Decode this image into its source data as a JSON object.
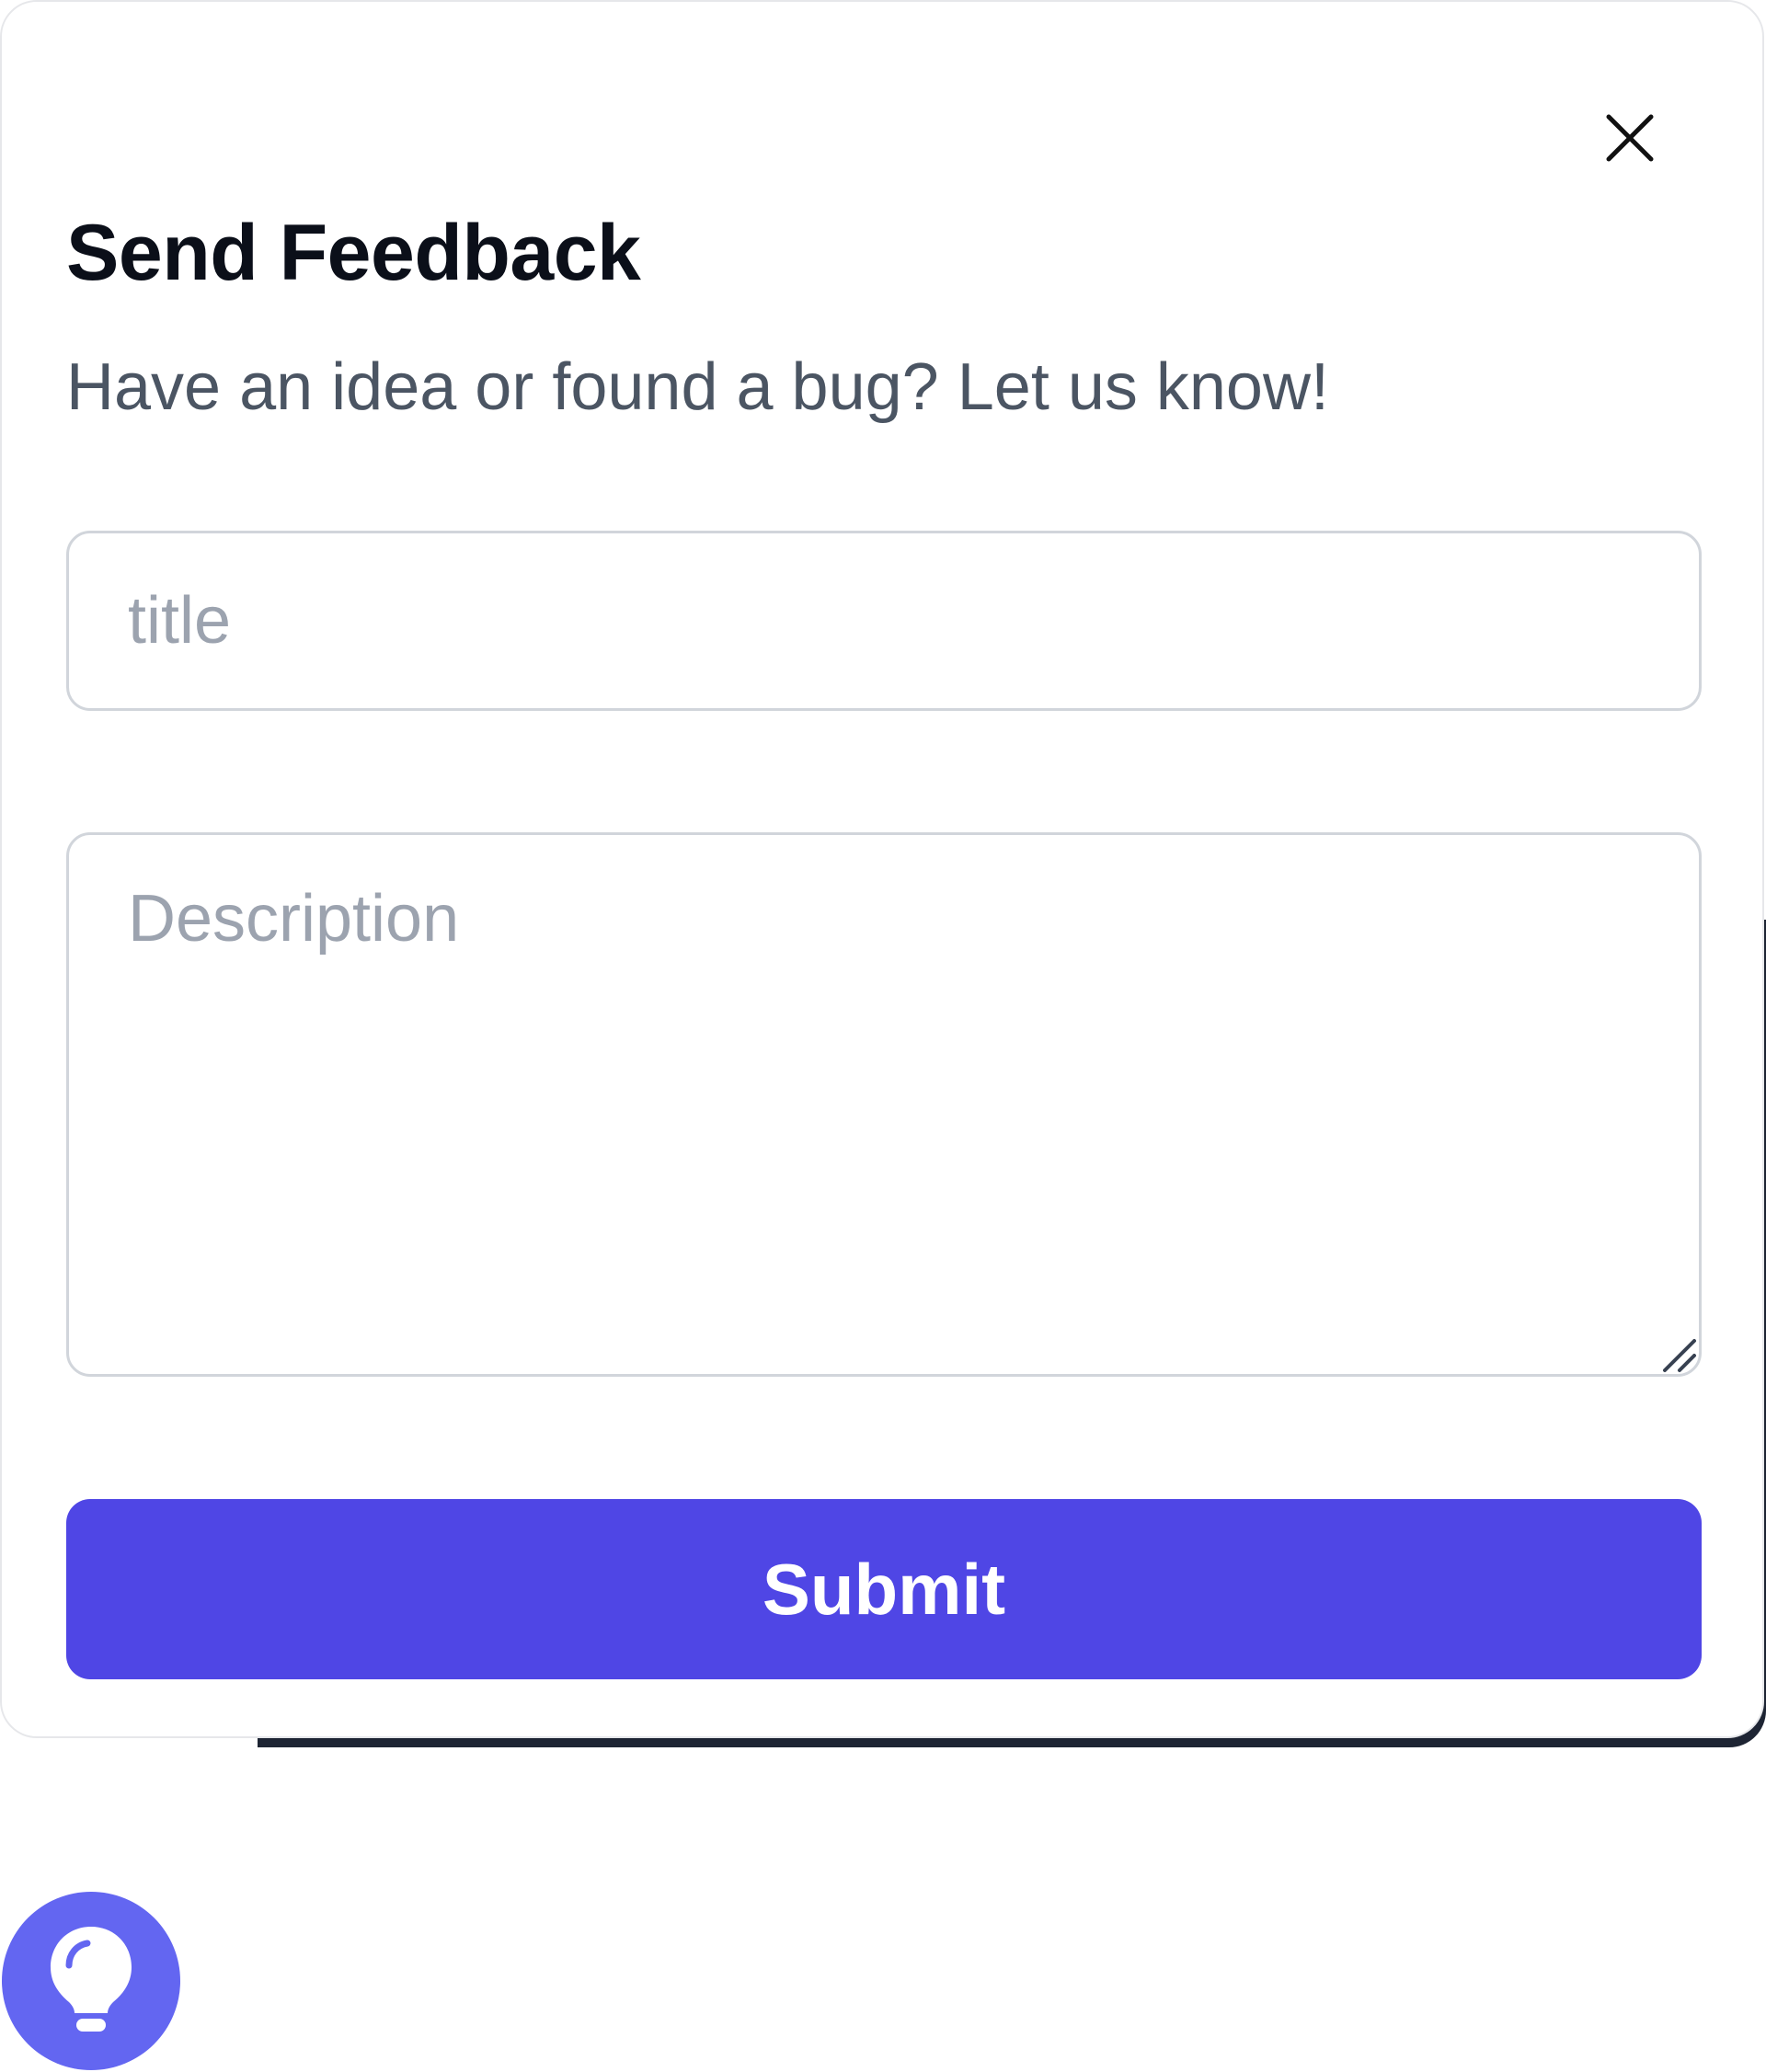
{
  "modal": {
    "title": "Send Feedback",
    "subtitle": "Have an idea or found a bug? Let us know!",
    "close_icon": "close-icon",
    "title_input": {
      "value": "",
      "placeholder": "title"
    },
    "description_input": {
      "value": "",
      "placeholder": "Description"
    },
    "submit_label": "Submit"
  },
  "fab": {
    "icon": "lightbulb-icon"
  },
  "colors": {
    "accent": "#4f46e5",
    "fab": "#6366f1",
    "title_text": "#0b0f19",
    "subtitle_text": "#4b5563",
    "placeholder": "#9ca3af",
    "border": "#d1d5db"
  }
}
